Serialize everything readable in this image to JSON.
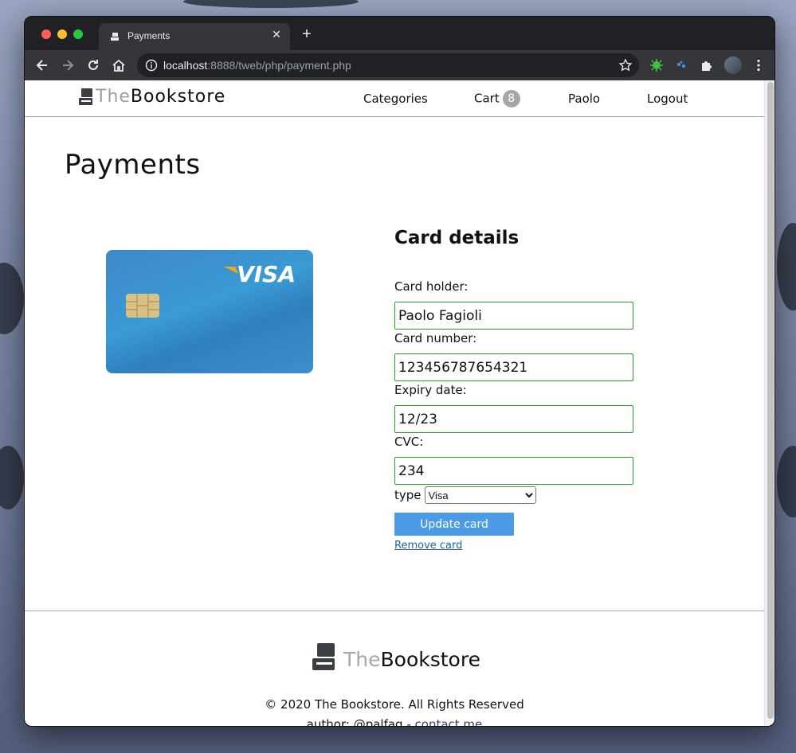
{
  "browser": {
    "tab_title": "Payments",
    "tab_close": "✕",
    "new_tab": "+",
    "url_host": "localhost",
    "url_rest": ":8888/tweb/php/payment.php"
  },
  "header": {
    "logo_the": "The",
    "logo_book": "Bookstore",
    "nav": {
      "categories": "Categories",
      "cart": "Cart",
      "cart_count": "8",
      "user": "Paolo",
      "logout": "Logout"
    }
  },
  "main": {
    "page_title": "Payments",
    "card_brand": "VISA",
    "details_title": "Card details",
    "form": {
      "holder_label": "Card holder:",
      "holder_value": "Paolo Fagioli",
      "number_label": "Card number:",
      "number_value": "123456787654321",
      "expiry_label": "Expiry date:",
      "expiry_value": "12/23",
      "cvc_label": "CVC:",
      "cvc_value": "234",
      "type_label": "type",
      "type_selected": "Visa",
      "update_button": "Update card",
      "remove_link": "Remove card"
    }
  },
  "footer": {
    "logo_the": "The",
    "logo_book": "Bookstore",
    "copyright": "© 2020 The Bookstore. All Rights Reserved",
    "author_prefix": "author: @palfag - ",
    "contact": "contact me"
  },
  "colors": {
    "accent_button": "#4b9be6",
    "input_border_valid": "#2e9b2e",
    "badge": "#a6a6a6",
    "card_blue": "#3a9ad3"
  }
}
